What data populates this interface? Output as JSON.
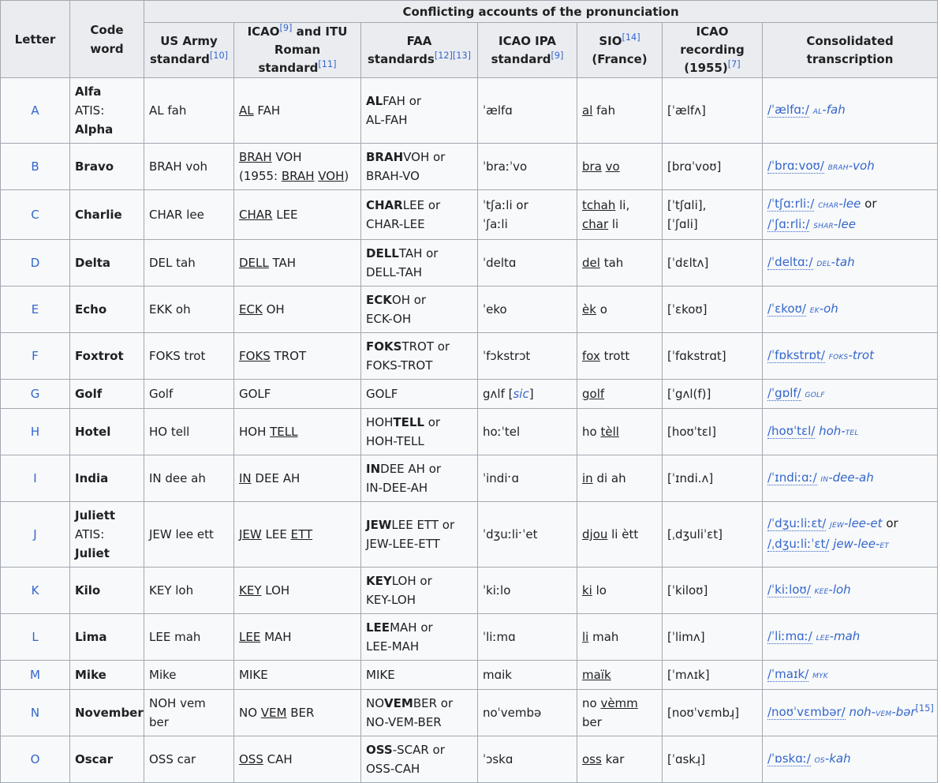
{
  "header": {
    "letter": "Letter",
    "code_word": "Code word",
    "group": "Conflicting accounts of the pronunciation",
    "us_army": "US Army standard",
    "us_army_ref": "[10]",
    "icao_itu_1": "ICAO",
    "icao_itu_ref1": "[9]",
    "icao_itu_2": " and ITU Roman standard",
    "icao_itu_ref2": "[11]",
    "faa": "FAA standards",
    "faa_ref1": "[12]",
    "faa_ref2": "[13]",
    "icao_ipa": "ICAO IPA standard",
    "icao_ipa_ref": "[9]",
    "sio": "SIO",
    "sio_ref": "[14]",
    "sio_country": "(France)",
    "icao_rec": "ICAO recording (1955)",
    "icao_rec_ref": "[7]",
    "consolidated": "Consolidated transcription"
  },
  "rows": {
    "a": {
      "letter": "A",
      "code": "Alfa",
      "atis_label": "ATIS: ",
      "atis": "Alpha",
      "army": "AL fah",
      "itu_u1": "AL",
      "itu_r1": " FAH",
      "faa_b": "AL",
      "faa_r": "FAH or",
      "faa_l2": "AL-FAH",
      "ipa": "ˈælfɑ",
      "sio_u1": "al",
      "sio_r1": " fah",
      "rec": "[ˈælfʌ]",
      "ct_ipa": "/ˈælfɑː/",
      "ct_sc": "al",
      "ct_rest": "-fah"
    },
    "b": {
      "letter": "B",
      "code": "Bravo",
      "army": "BRAH voh",
      "itu_u1": "BRAH",
      "itu_r1": " VOH",
      "itu_l2a": "(1955: ",
      "itu_l2u1": "BRAH",
      "itu_l2u2": "VOH",
      "itu_l2c": ")",
      "faa_b": "BRAH",
      "faa_r": "VOH or",
      "faa_l2": "BRAH-VO",
      "ipa": "ˈbraːˈvo",
      "sio_u1": "bra",
      "sio_u2": "vo",
      "rec": "[brɑˈvoʊ]",
      "ct_ipa": "/ˈbrɑːvoʊ/",
      "ct_sc": "brah",
      "ct_rest": "-voh"
    },
    "c": {
      "letter": "C",
      "code": "Charlie",
      "army": "CHAR lee",
      "itu_u1": "CHAR",
      "itu_r1": " LEE",
      "faa_b": "CHAR",
      "faa_r": "LEE or",
      "faa_l2": "CHAR-LEE",
      "ipa_l1": "ˈtʃaːli  or",
      "ipa_l2": "ˈʃaːli",
      "sio_u1": "tchah",
      "sio_r1": " li,",
      "sio_u2": "char",
      "sio_r2": " li",
      "rec_l1": "[ˈtʃɑli],",
      "rec_l2": "[ˈʃɑli]",
      "ct_ipa": "/ˈtʃɑːrli:/",
      "ct_sc": "char",
      "ct_rest": "-lee",
      "ct_or": " or",
      "ct_ipa2": "/ˈʃɑːrli:/",
      "ct_sc2": "shar",
      "ct_rest2": "-lee"
    },
    "d": {
      "letter": "D",
      "code": "Delta",
      "army": "DEL tah",
      "itu_u1": "DELL",
      "itu_r1": " TAH",
      "faa_b": "DELL",
      "faa_r": "TAH or",
      "faa_l2": "DELL-TAH",
      "ipa": "ˈdeltɑ",
      "sio_u1": "del",
      "sio_r1": " tah",
      "rec": "[ˈdɛltʌ]",
      "ct_ipa": "/ˈdeltɑː/",
      "ct_sc": "del",
      "ct_rest": "-tah"
    },
    "e": {
      "letter": "E",
      "code": "Echo",
      "army": "EKK oh",
      "itu_u1": "ECK",
      "itu_r1": " OH",
      "faa_b": "ECK",
      "faa_r": "OH or",
      "faa_l2": "ECK-OH",
      "ipa": "ˈeko",
      "sio_u1": "èk",
      "sio_r1": " o",
      "rec": "[ˈɛkoʊ]",
      "ct_ipa": "/ˈɛkoʊ/",
      "ct_sc": "ek",
      "ct_rest": "-oh"
    },
    "f": {
      "letter": "F",
      "code": "Foxtrot",
      "army": "FOKS trot",
      "itu_u1": "FOKS",
      "itu_r1": " TROT",
      "faa_b": "FOKS",
      "faa_r": "TROT or",
      "faa_l2": "FOKS-TROT",
      "ipa": "ˈfɔkstrɔt",
      "sio_u1": "fox",
      "sio_r1": " trott",
      "rec": "[ˈfɑkstrɑt]",
      "ct_ipa": "/ˈfɒkstrɒt/",
      "ct_sc": "foks",
      "ct_rest": "-trot"
    },
    "g": {
      "letter": "G",
      "code": "Golf",
      "army": "Golf",
      "itu": "GOLF",
      "faa": "GOLF",
      "ipa_a": "gʌlf [",
      "ipa_sic": "sic",
      "ipa_b": "]",
      "sio_u1": "golf",
      "rec": "[ˈgʌl(f)]",
      "ct_ipa": "/ˈgɒlf/",
      "ct_sc": "golf"
    },
    "h": {
      "letter": "H",
      "code": "Hotel",
      "army": "HO tell",
      "itu_r0": "HOH ",
      "itu_u1": "TELL",
      "faa_r0": "HOH",
      "faa_b": "TELL",
      "faa_r": " or",
      "faa_l2": "HOH-TELL",
      "ipa": "hoːˈtel",
      "sio_r0": "ho ",
      "sio_u1": "tèll",
      "rec": "[hoʊˈtɛl]",
      "ct_ipa": "/hoʊˈtɛl/",
      "ct_pre": "hoh-",
      "ct_sc": "tel"
    },
    "i": {
      "letter": "I",
      "code": "India",
      "army": "IN dee ah",
      "itu_u1": "IN",
      "itu_r1": " DEE AH",
      "faa_b": "IN",
      "faa_r": "DEE AH or",
      "faa_l2": "IN-DEE-AH",
      "ipa": "ˈindiˑɑ",
      "sio_u1": "in",
      "sio_r1": " di ah",
      "rec": "[ˈɪndi.ʌ]",
      "ct_ipa": "/ˈɪndiːɑː/",
      "ct_sc": "in",
      "ct_rest": "-dee-ah"
    },
    "j": {
      "letter": "J",
      "code": "Juliett",
      "atis_label": "ATIS: ",
      "atis": "Juliet",
      "army": "JEW lee ett",
      "itu_u1": "JEW",
      "itu_r1": " LEE ",
      "itu_u2": "ETT",
      "faa_b": "JEW",
      "faa_r": "LEE ETT or",
      "faa_l2": "JEW-LEE-ETT",
      "ipa": "ˈdʒuːliˑˈet",
      "sio_u1": "djou",
      "sio_r1": " li ètt",
      "rec": "[ˌdʒuliˈɛt]",
      "ct_ipa": "/ˈdʒuːliːɛt/",
      "ct_sc": "jew",
      "ct_rest": "-lee-et",
      "ct_or": " or",
      "ct_ipa2": "/ˌdʒuːliːˈɛt/",
      "ct_pre2": "jew-lee-",
      "ct_sc2": "et"
    },
    "k": {
      "letter": "K",
      "code": "Kilo",
      "army": "KEY loh",
      "itu_u1": "KEY",
      "itu_r1": " LOH",
      "faa_b": "KEY",
      "faa_r": "LOH or",
      "faa_l2": "KEY-LOH",
      "ipa": "ˈkiːlo",
      "sio_u1": "ki",
      "sio_r1": " lo",
      "rec": "[ˈkiloʊ]",
      "ct_ipa": "/ˈkiːloʊ/",
      "ct_sc": "kee",
      "ct_rest": "-loh"
    },
    "l": {
      "letter": "L",
      "code": "Lima",
      "army": "LEE mah",
      "itu_u1": "LEE",
      "itu_r1": " MAH",
      "faa_b": "LEE",
      "faa_r": "MAH or",
      "faa_l2": "LEE-MAH",
      "ipa": "ˈliːmɑ",
      "sio_u1": "li",
      "sio_r1": " mah",
      "rec": "[ˈlimʌ]",
      "ct_ipa": "/ˈliːmɑː/",
      "ct_sc": "lee",
      "ct_rest": "-mah"
    },
    "m": {
      "letter": "M",
      "code": "Mike",
      "army": "Mike",
      "itu": "MIKE",
      "faa": "MIKE",
      "ipa": "mɑik",
      "sio_u1": "maïk",
      "rec": "[ˈmʌɪk]",
      "ct_ipa": "/ˈmaɪk/",
      "ct_sc": "myk"
    },
    "n": {
      "letter": "N",
      "code": "November",
      "army": "NOH vem ber",
      "itu_r0": "NO ",
      "itu_u1": "VEM",
      "itu_r1": " BER",
      "faa_r0": "NO",
      "faa_b": "VEM",
      "faa_r": "BER or",
      "faa_l2": "NO-VEM-BER",
      "ipa": "noˈvembə",
      "sio_r0": "no ",
      "sio_u1": "vèmm",
      "sio_r1": " ber",
      "rec": "[noʊˈvɛmbɹ̩]",
      "ct_ipa": "/noʊˈvɛmbər/",
      "ct_pre": "noh-",
      "ct_sc": "vem",
      "ct_rest": "-bər",
      "ct_ref": "[15]"
    },
    "o": {
      "letter": "O",
      "code": "Oscar",
      "army": "OSS car",
      "itu_u1": "OSS",
      "itu_r1": " CAH",
      "faa_b": "OSS",
      "faa_r": "-SCAR or",
      "faa_l2": "OSS-CAH",
      "ipa": "ˈɔskɑ",
      "sio_u1": "oss",
      "sio_r1": " kar",
      "rec": "[ˈɑskɹ̩]",
      "ct_ipa": "/ˈɒskɑː/",
      "ct_sc": "os",
      "ct_rest": "-kah"
    }
  }
}
